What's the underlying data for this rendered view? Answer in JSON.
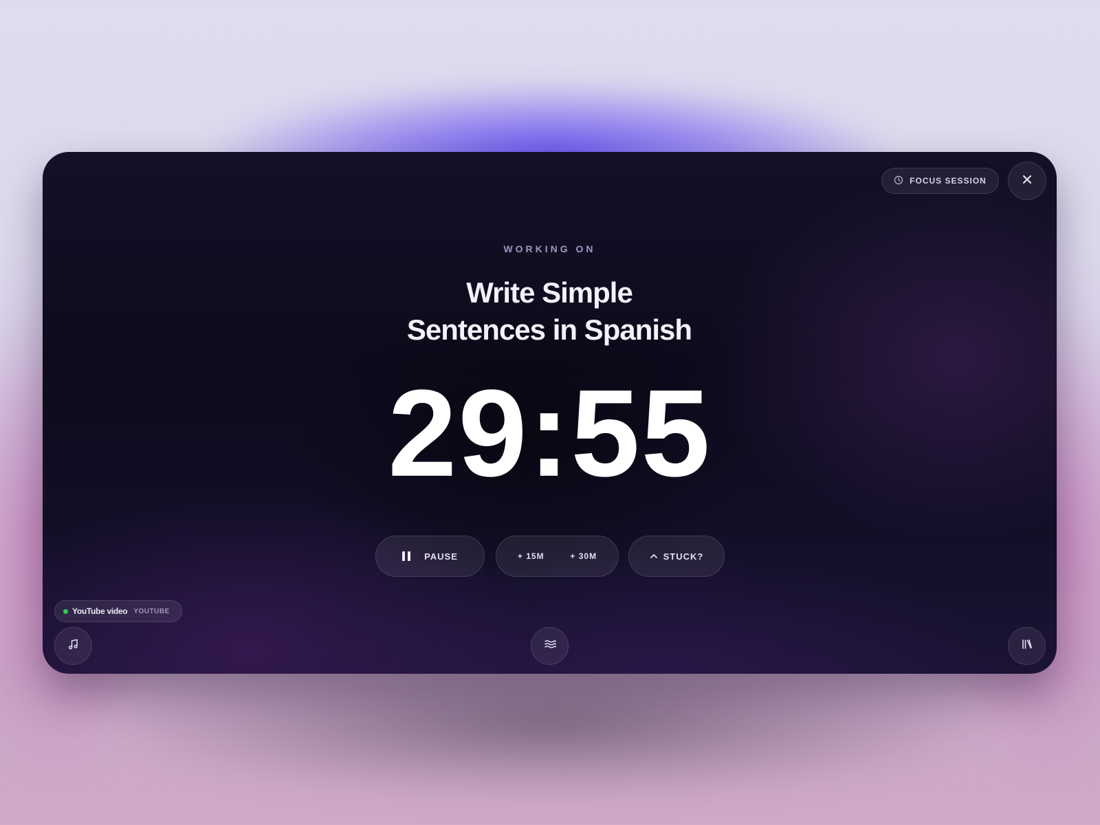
{
  "header": {
    "session_label": "FOCUS SESSION",
    "session_icon": "clock-icon",
    "close_icon": "close-icon"
  },
  "task": {
    "eyebrow": "WORKING ON",
    "title_line1": "Write Simple",
    "title_line2": "Sentences in Spanish"
  },
  "timer": {
    "display": "29:55"
  },
  "controls": {
    "pause_label": "PAUSE",
    "pause_icon": "pause-icon",
    "add_15_label": "+ 15M",
    "add_30_label": "+ 30M",
    "stuck_label": "STUCK?",
    "stuck_icon": "chevron-up-icon"
  },
  "media": {
    "source_title": "YouTube video",
    "source_tag": "YOUTUBE",
    "status_color": "#34c759"
  },
  "footer": {
    "left_icon": "music-note-icon",
    "center_icon": "waves-icon",
    "right_icon": "library-icon"
  },
  "colors": {
    "accent_glow": "#5c46eb",
    "card_background": "#0d0b1c",
    "label_muted": "#9e98c2"
  }
}
